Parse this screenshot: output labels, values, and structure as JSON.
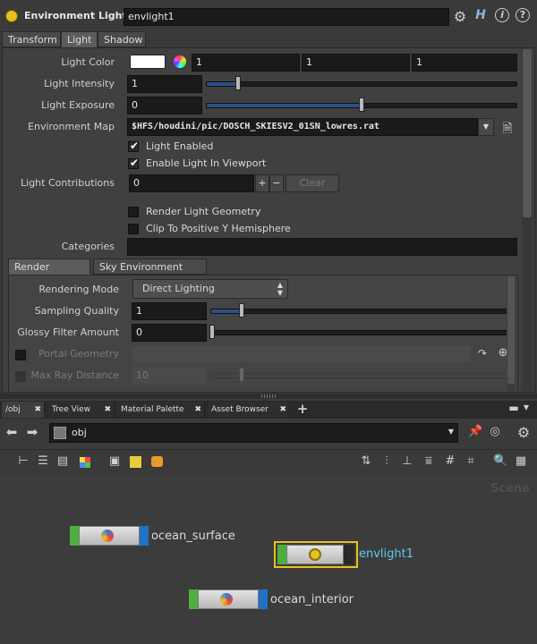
{
  "header": {
    "node_type": "Environment Light",
    "node_name": "envlight1"
  },
  "tabs": [
    {
      "label": "Transform"
    },
    {
      "label": "Light"
    },
    {
      "label": "Shadow"
    }
  ],
  "light": {
    "light_color": {
      "label": "Light Color",
      "values": [
        "1",
        "1",
        "1"
      ],
      "swatch": "#ffffff"
    },
    "light_intensity": {
      "label": "Light Intensity",
      "value": "1",
      "fraction": 0.1
    },
    "light_exposure": {
      "label": "Light Exposure",
      "value": "0",
      "fraction": 0.5
    },
    "environment_map": {
      "label": "Environment Map",
      "value": "$HFS/houdini/pic/DOSCH_SKIESV2_01SN_lowres.rat"
    },
    "light_enabled": {
      "label": "Light Enabled",
      "checked": true
    },
    "enable_in_viewport": {
      "label": "Enable Light In Viewport",
      "checked": true
    },
    "light_contributions": {
      "label": "Light Contributions",
      "value": "0",
      "clear_label": "Clear"
    },
    "render_light_geometry": {
      "label": "Render Light Geometry",
      "checked": false
    },
    "clip_positive_y": {
      "label": "Clip To Positive Y Hemisphere",
      "checked": false
    },
    "categories": {
      "label": "Categories",
      "value": ""
    }
  },
  "subtabs": [
    {
      "label": "Render Options"
    },
    {
      "label": "Sky Environment Map"
    }
  ],
  "render_options": {
    "rendering_mode": {
      "label": "Rendering Mode",
      "value": "Direct Lighting"
    },
    "sampling_quality": {
      "label": "Sampling Quality",
      "value": "1",
      "fraction": 0.1
    },
    "glossy_filter": {
      "label": "Glossy Filter Amount",
      "value": "0",
      "fraction": 0.0
    },
    "portal_geometry": {
      "label": "Portal Geometry",
      "value": ""
    },
    "max_ray_distance": {
      "label": "Max Ray Distance",
      "value": "10"
    }
  },
  "network_tabs": [
    {
      "label": "/obj"
    },
    {
      "label": "Tree View"
    },
    {
      "label": "Material Palette"
    },
    {
      "label": "Asset Browser"
    }
  ],
  "path": "obj",
  "context_label": "Scene",
  "nodes": [
    {
      "name": "ocean_surface"
    },
    {
      "name": "envlight1"
    },
    {
      "name": "ocean_interior"
    }
  ],
  "icons": {
    "gear": "gear-icon",
    "help": "help-icon",
    "info": "info-icon"
  },
  "colors": {
    "selected_node_border": "#e6c21a",
    "selected_node_text": "#5ec8f5",
    "node_green": "#4faf3e",
    "node_blue": "#1f73c4"
  }
}
